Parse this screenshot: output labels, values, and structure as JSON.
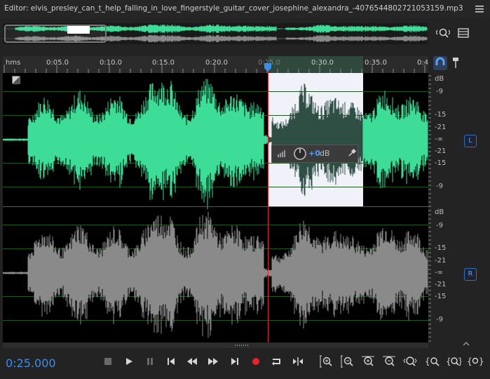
{
  "editor": {
    "title": "Editor: elvis_presley_can_t_help_falling_in_love_fingerstyle_guitar_cover_josephine_alexandra_-4076544802721053159.mp3"
  },
  "ruler": {
    "unit_label": "hms",
    "ticks": [
      "0:05.0",
      "0:10.0",
      "0:15.0",
      "0:20.0",
      "0:25.0",
      "0:30.0",
      "0:35.0",
      "0:4"
    ]
  },
  "db_scale": {
    "left_channel": [
      "dB",
      "-9",
      "-15",
      "-21",
      "-∞",
      "-21",
      "-15",
      "-9"
    ],
    "right_channel": [
      "dB",
      "-9",
      "-15",
      "-21",
      "-∞",
      "-21",
      "-15",
      "-9"
    ]
  },
  "channels": {
    "left_badge": "L",
    "right_badge": "R"
  },
  "hud": {
    "gain_value": "+0",
    "gain_unit": "dB"
  },
  "transport": {
    "current_time": "0:25.000"
  },
  "colors": {
    "left_waveform": "#3ddc97",
    "right_waveform": "#8a8a8a",
    "selected_waveform": "#2f4f45",
    "playhead": "#e0262a",
    "accent": "#3d8ef0"
  }
}
